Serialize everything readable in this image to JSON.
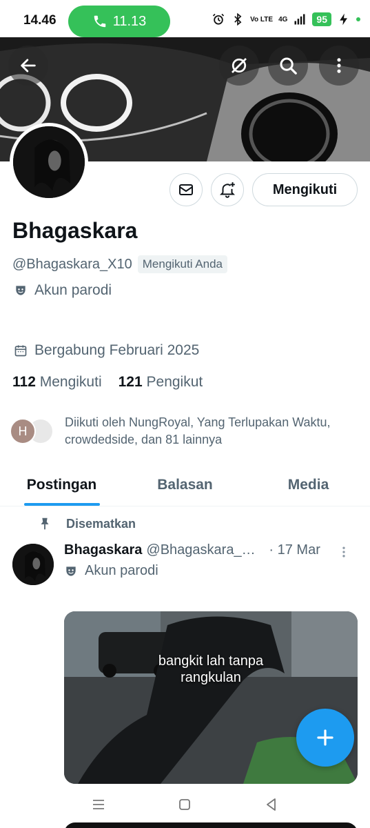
{
  "status_bar": {
    "time": "14.46",
    "call_duration": "11.13",
    "network_volte": "Vo LTE",
    "network_type": "4G",
    "battery": "95",
    "icons": [
      "alarm-icon",
      "bluetooth-icon",
      "volte-icon",
      "signal-icon",
      "battery-icon",
      "charging-icon"
    ]
  },
  "banner": {
    "buttons": [
      "back-arrow-icon",
      "grok-icon",
      "search-icon",
      "more-vertical-icon"
    ]
  },
  "profile": {
    "display_name": "Bhagaskara",
    "handle": "@Bhagaskara_X10",
    "follows_you_badge": "Mengikuti Anda",
    "parody_label": "Akun parodi",
    "joined": "Bergabung Februari 2025",
    "following_count": "112",
    "following_label": "Mengikuti",
    "followers_count": "121",
    "followers_label": "Pengikut",
    "followed_by_initial": "H",
    "followed_by_text": "Diikuti oleh NungRoyal, Yang Terlupakan Waktu, crowdedside, dan 81 lainnya",
    "follow_button": "Mengikuti"
  },
  "tabs": [
    {
      "label": "Postingan",
      "active": true
    },
    {
      "label": "Balasan",
      "active": false
    },
    {
      "label": "Media",
      "active": false
    }
  ],
  "post": {
    "pinned_label": "Disematkan",
    "author_name": "Bhagaskara",
    "author_handle": "@Bhagaskara_X10",
    "date": "· 17 Mar",
    "parody_label": "Akun parodi",
    "media_caption_line1": "bangkit lah tanpa",
    "media_caption_line2": "rangkulan"
  },
  "colors": {
    "accent": "#1d9bf0",
    "call_green": "#35c159",
    "secondary_text": "#536471"
  }
}
